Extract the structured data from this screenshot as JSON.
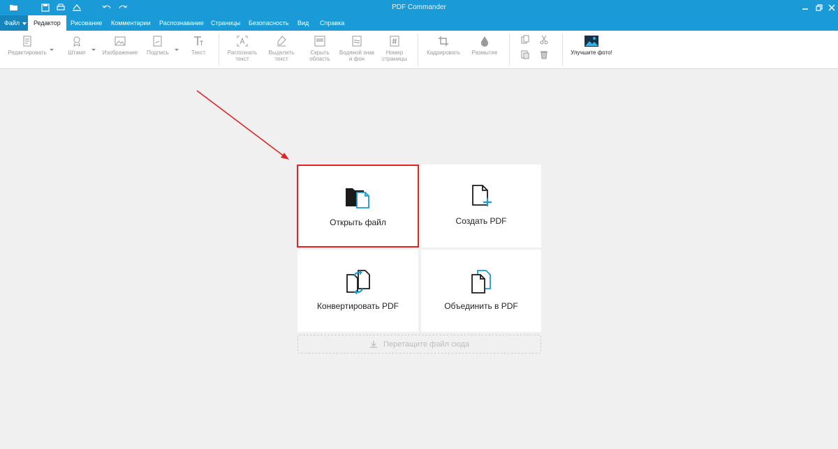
{
  "window": {
    "title": "PDF Commander"
  },
  "menu": {
    "file": "Файл",
    "tabs": [
      "Редактор",
      "Рисование",
      "Комментарии",
      "Распознавание",
      "Страницы",
      "Безопасность",
      "Вид",
      "Справка"
    ]
  },
  "ribbon": {
    "edit": "Редактировать",
    "stamp": "Штамп",
    "image": "Изображение",
    "signature": "Подпись",
    "text": "Текст",
    "ocr_line1": "Распознать",
    "ocr_line2": "текст",
    "select_line1": "Выделить",
    "select_line2": "текст",
    "hide_line1": "Скрыть",
    "hide_line2": "область",
    "watermark_line1": "Водяной знак",
    "watermark_line2": "и фон",
    "pagenum_line1": "Номер",
    "pagenum_line2": "страницы",
    "crop": "Кадрировать",
    "blur": "Размытие",
    "enhance": "Улучшите фото!"
  },
  "cards": {
    "open": "Открыть файл",
    "create": "Создать PDF",
    "convert": "Конвертировать PDF",
    "merge": "Объединить в PDF"
  },
  "dropzone": {
    "label": "Перетащите файл сюда"
  },
  "colors": {
    "accent": "#1a9ad6",
    "highlight": "#e02424",
    "icon_blue": "#1a9ad6"
  },
  "icons": {
    "open": "folder-file-icon",
    "create": "new-file-plus-icon",
    "convert": "convert-arrows-icon",
    "merge": "merge-files-icon",
    "drop": "download-arrow-icon"
  }
}
